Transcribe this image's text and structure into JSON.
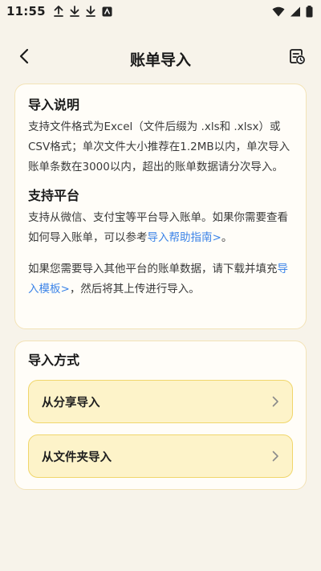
{
  "status_bar": {
    "time": "11:55",
    "icons_left": [
      "upload-icon",
      "download-icon",
      "download-icon",
      "app-notification-icon"
    ],
    "icons_right": [
      "wifi-icon",
      "signal-icon",
      "battery-icon"
    ]
  },
  "header": {
    "title": "账单导入",
    "back_icon": "back-chevron-icon",
    "right_icon": "import-records-icon"
  },
  "info_card": {
    "section1_title": "导入说明",
    "section1_body": "支持文件格式为Excel（文件后缀为 .xls和 .xlsx）或CSV格式；单次文件大小推荐在1.2MB以内，单次导入账单条数在3000以内，超出的账单数据请分次导入。",
    "section2_title": "支持平台",
    "section2_body_before": "支持从微信、支付宝等平台导入账单。如果你需要查看如何导入账单，可以参考",
    "section2_link": "导入帮助指南>",
    "section2_body_after": "。",
    "section3_body_before": "如果您需要导入其他平台的账单数据，请下载并填充",
    "section3_link": "导入模板>",
    "section3_body_after": "，然后将其上传进行导入。"
  },
  "methods_card": {
    "title": "导入方式",
    "options": [
      {
        "label": "从分享导入",
        "icon": "chevron-right-icon"
      },
      {
        "label": "从文件夹导入",
        "icon": "chevron-right-icon"
      }
    ]
  },
  "colors": {
    "background": "#F7F3EA",
    "card": "#FFFDF8",
    "card_border": "#F3E3B7",
    "option_fill": "#FDF3C9",
    "option_border": "#F0D66B",
    "link": "#3C84E8"
  }
}
